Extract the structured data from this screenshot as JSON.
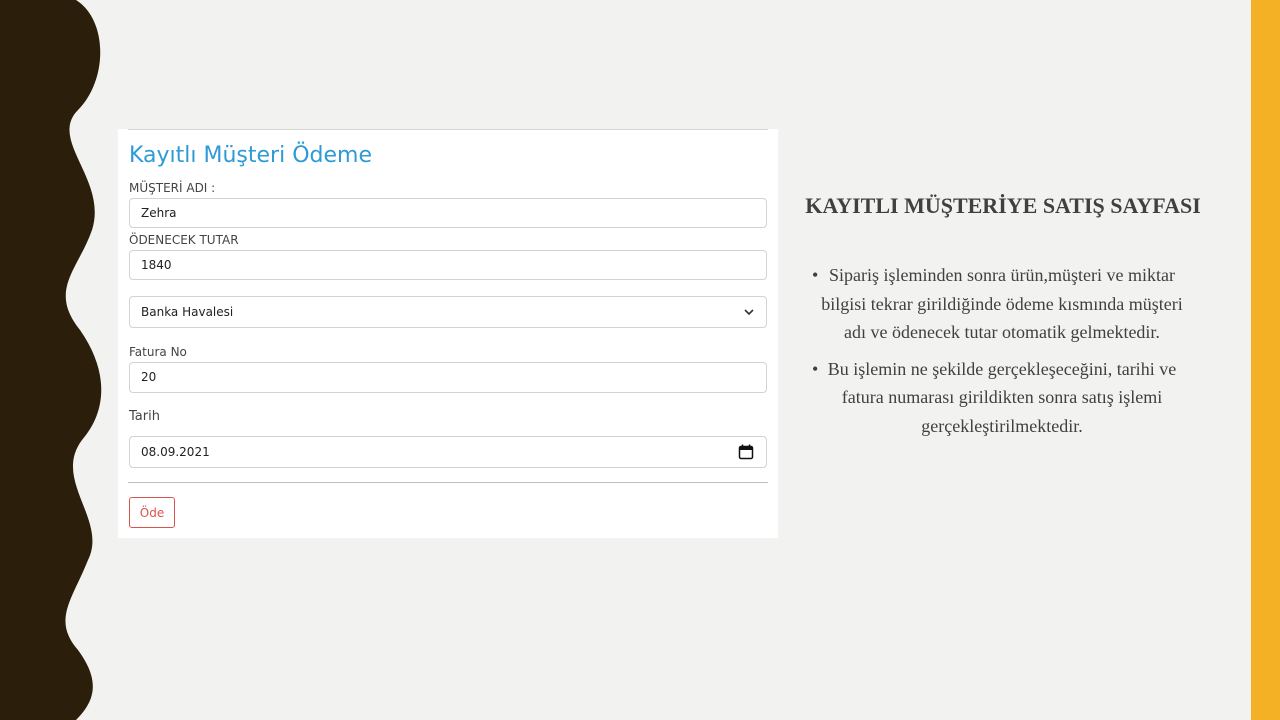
{
  "slide": {
    "title": "KAYITLI MÜŞTERİYE SATIŞ SAYFASI",
    "bullets": [
      "Sipariş işleminden sonra ürün,müşteri ve miktar bilgisi tekrar girildiğinde ödeme kısmında müşteri adı ve ödenecek tutar otomatik gelmektedir.",
      "Bu işlemin ne şekilde gerçekleşeceğini, tarihi ve fatura numarası girildikten sonra satış işlemi gerçekleştirilmektedir."
    ],
    "colors": {
      "background": "#f2f2f0",
      "wave_strip": "#2b1e0a",
      "accent_bar": "#f4b125",
      "text": "#404040"
    }
  },
  "form": {
    "title": "Kayıtlı Müşteri Ödeme",
    "title_color": "#2e9ad6",
    "customer_name_label": "MÜŞTERİ ADI :",
    "customer_name_value": "Zehra",
    "amount_label": "ÖDENECEK TUTAR",
    "amount_value": "1840",
    "payment_method_value": "Banka Havalesi",
    "invoice_label": "Fatura No",
    "invoice_value": "20",
    "date_label": "Tarih",
    "date_value": "08.09.2021",
    "pay_button_label": "Öde",
    "pay_button_color": "#d9534f",
    "icons": {
      "select": "chevron-down-icon",
      "date": "calendar-icon"
    }
  }
}
